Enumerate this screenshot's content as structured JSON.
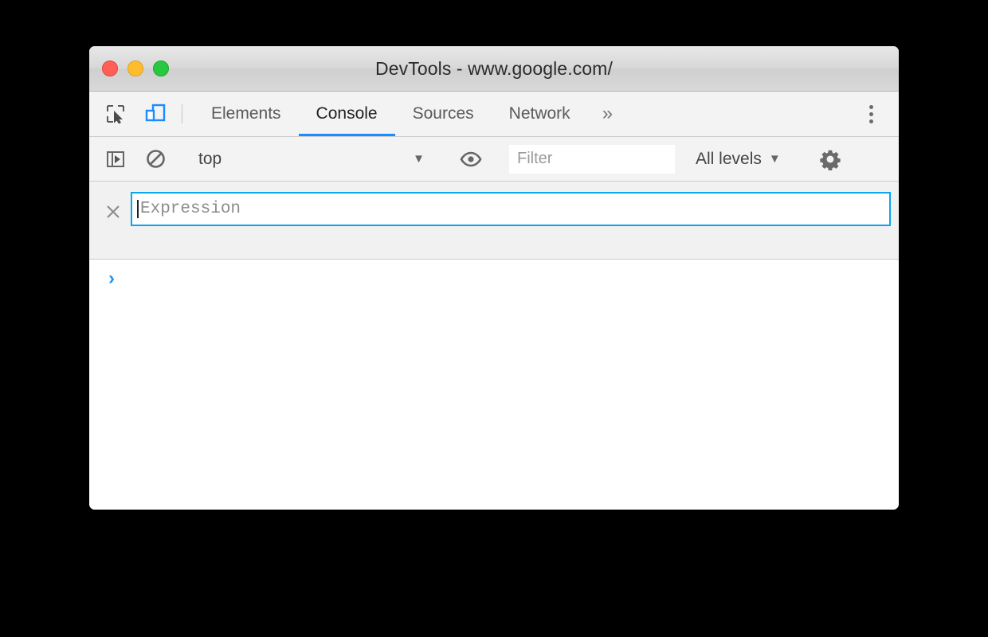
{
  "window": {
    "title": "DevTools - www.google.com/",
    "traffic_lights": [
      {
        "name": "close",
        "color": "#ff5f57"
      },
      {
        "name": "minimize",
        "color": "#ffbd2e"
      },
      {
        "name": "zoom",
        "color": "#28c840"
      }
    ]
  },
  "tabbar": {
    "inspect_icon": "inspect-element-icon",
    "device_icon": "device-toolbar-icon",
    "tabs": [
      {
        "label": "Elements",
        "active": false
      },
      {
        "label": "Console",
        "active": true
      },
      {
        "label": "Sources",
        "active": false
      },
      {
        "label": "Network",
        "active": false
      }
    ],
    "overflow_label": "»",
    "more_menu_icon": "kebab-menu-icon",
    "active_underline_color": "#1a8cff"
  },
  "console_toolbar": {
    "sidebar_toggle_icon": "console-sidebar-toggle-icon",
    "clear_icon": "clear-console-icon",
    "context": {
      "value": "top",
      "caret": "▼"
    },
    "live_expression_icon": "eye-icon",
    "filter": {
      "value": "",
      "placeholder": "Filter"
    },
    "levels": {
      "value": "All levels",
      "caret": "▼"
    },
    "settings_icon": "gear-icon"
  },
  "live_expression": {
    "close_label": "×",
    "value": "",
    "placeholder": "Expression",
    "focus_border_color": "#0aa5f0"
  },
  "console_output": {
    "prompt": "›",
    "prompt_color": "#2196f3",
    "messages": []
  }
}
